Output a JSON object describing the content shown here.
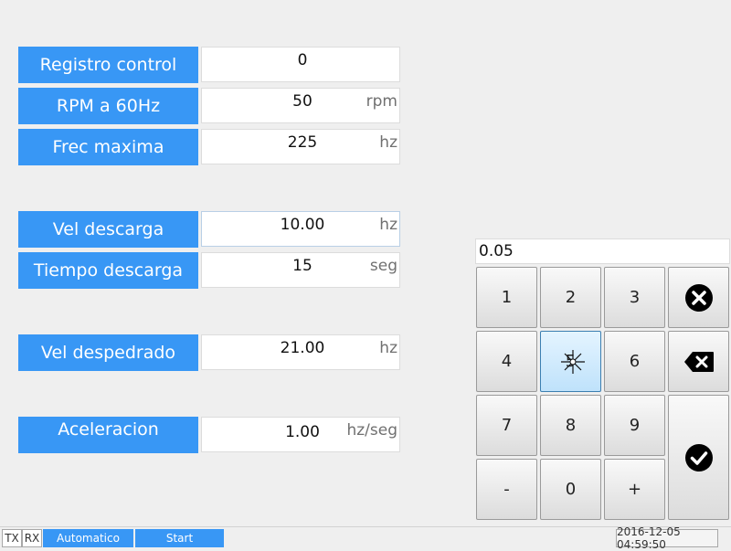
{
  "form": {
    "registro_control": {
      "label": "Registro control",
      "value": "0",
      "unit": ""
    },
    "rpm_60hz": {
      "label": "RPM a 60Hz",
      "value": "50",
      "unit": "rpm"
    },
    "frec_maxima": {
      "label": "Frec maxima",
      "value": "225",
      "unit": "hz"
    },
    "vel_descarga": {
      "label": "Vel descarga",
      "value": "10.00",
      "unit": "hz"
    },
    "tiempo_descarga": {
      "label": "Tiempo descarga",
      "value": "15",
      "unit": "seg"
    },
    "vel_despedrado": {
      "label": "Vel despedrado",
      "value": "21.00",
      "unit": "hz"
    },
    "aceleracion": {
      "label": "Aceleracion",
      "value": "1.00",
      "unit": "hz/seg"
    }
  },
  "keypad": {
    "display": "0.05",
    "keys": {
      "k1": "1",
      "k2": "2",
      "k3": "3",
      "k4": "4",
      "k5": "5",
      "k6": "6",
      "k7": "7",
      "k8": "8",
      "k9": "9",
      "minus": "-",
      "zero": "0",
      "plus": "+"
    },
    "icons": {
      "clear": "close-circle-icon",
      "backspace": "backspace-icon",
      "confirm": "check-circle-icon"
    }
  },
  "status_bar": {
    "tx": "TX",
    "rx": "RX",
    "mode": "Automatico",
    "start": "Start",
    "datetime": "2016-12-05 04:59:50"
  },
  "colors": {
    "accent": "#3897f5",
    "background": "#efefef",
    "key_pressed": "#bfe2fb"
  }
}
